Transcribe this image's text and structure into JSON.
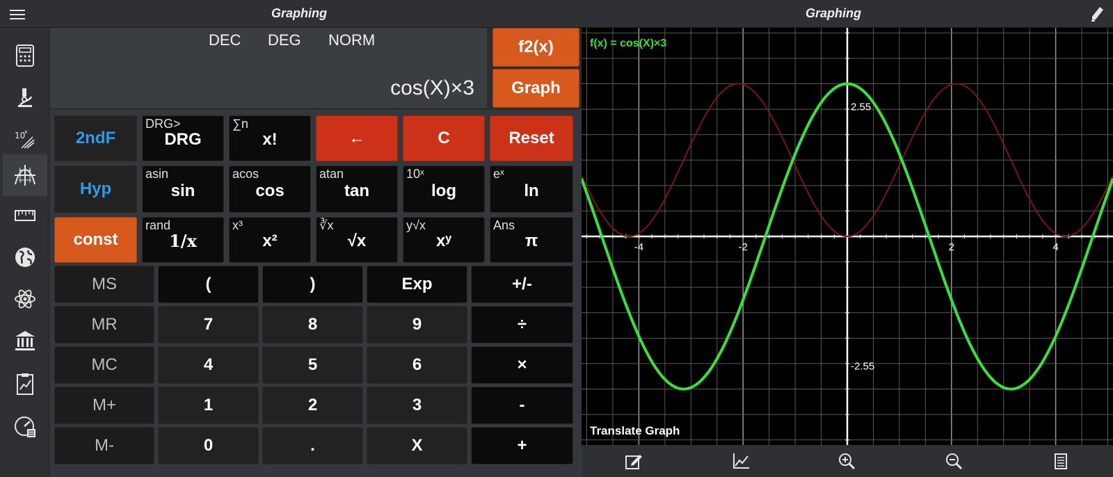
{
  "topbar": {
    "title_left": "Graphing",
    "title_right": "Graphing",
    "menu_icon": "hamburger-icon",
    "pen_icon": "pen-icon"
  },
  "sidebar": {
    "items": [
      {
        "name": "calculator",
        "icon": "calculator-icon"
      },
      {
        "name": "science",
        "icon": "microscope-icon"
      },
      {
        "name": "scientific-notation",
        "icon": "power-of-ten-icon"
      },
      {
        "name": "graphing",
        "icon": "graph-axes-icon",
        "active": true
      },
      {
        "name": "ruler",
        "icon": "ruler-icon"
      },
      {
        "name": "globe",
        "icon": "globe-icon"
      },
      {
        "name": "atom",
        "icon": "atom-icon"
      },
      {
        "name": "bank",
        "icon": "bank-icon"
      },
      {
        "name": "report",
        "icon": "clipboard-chart-icon"
      },
      {
        "name": "gauge",
        "icon": "gauge-icon"
      }
    ]
  },
  "display": {
    "mode_base": "DEC",
    "mode_angle": "DEG",
    "mode_format": "NORM",
    "expression": "cos(X)×3"
  },
  "side_buttons": {
    "f2x": "f2(x)",
    "graph": "Graph"
  },
  "keys": {
    "row1": [
      {
        "main": "2ndF",
        "sub": ""
      },
      {
        "main": "DRG",
        "sub": "DRG>"
      },
      {
        "main": "x!",
        "sub": "∑n"
      },
      {
        "main": "←",
        "sub": ""
      },
      {
        "main": "C",
        "sub": ""
      },
      {
        "main": "Reset",
        "sub": ""
      }
    ],
    "row2": [
      {
        "main": "Hyp",
        "sub": ""
      },
      {
        "main": "sin",
        "sub": "asin"
      },
      {
        "main": "cos",
        "sub": "acos"
      },
      {
        "main": "tan",
        "sub": "atan"
      },
      {
        "main": "log",
        "sub": "10ˣ"
      },
      {
        "main": "ln",
        "sub": "eˣ"
      }
    ],
    "row3": [
      {
        "main": "const",
        "sub": ""
      },
      {
        "main": "1/x",
        "sub": "rand"
      },
      {
        "main": "x²",
        "sub": "x³"
      },
      {
        "main": "√x",
        "sub": "∛x"
      },
      {
        "main": "xʸ",
        "sub": "y√x"
      },
      {
        "main": "π",
        "sub": "Ans"
      }
    ],
    "row4": [
      "MS",
      "(",
      ")",
      "Exp",
      "+/-"
    ],
    "row5": [
      "MR",
      "7",
      "8",
      "9",
      "÷"
    ],
    "row6": [
      "MC",
      "4",
      "5",
      "6",
      "×"
    ],
    "row7": [
      "M+",
      "1",
      "2",
      "3",
      "-"
    ],
    "row8": [
      "M-",
      "0",
      ".",
      "X",
      "+"
    ]
  },
  "graph": {
    "function_label": "f(x) = cos(X)×3",
    "mode_label": "Translate Graph",
    "x_ticks": [
      "-4",
      "-2",
      "2",
      "4"
    ],
    "y_ticks": [
      "2.55",
      "-2.55"
    ],
    "xlim": [
      -5.1,
      5.1
    ],
    "ylim": [
      -4.1,
      4.1
    ],
    "x_grid_step": 0.5,
    "y_grid_step": 0.5,
    "primary_color": "#33e633",
    "secondary_color": "#7a1616",
    "toolbar": [
      "edit-icon",
      "chart-icon",
      "zoom-in-icon",
      "zoom-out-icon",
      "list-icon"
    ]
  }
}
